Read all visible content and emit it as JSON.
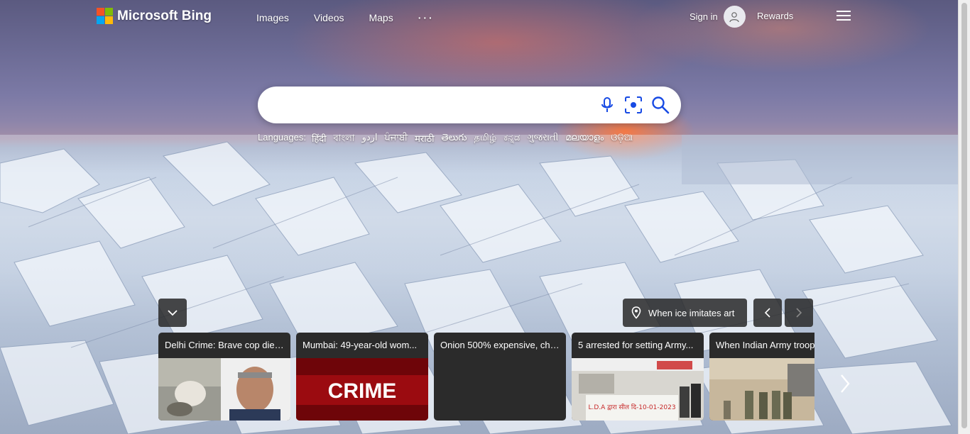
{
  "header": {
    "logo_text": "Microsoft Bing",
    "logo_colors": [
      "#f35325",
      "#81bc06",
      "#05a6f0",
      "#ffba08"
    ],
    "nav": [
      {
        "label": "Images"
      },
      {
        "label": "Videos"
      },
      {
        "label": "Maps"
      },
      {
        "label": "···"
      }
    ],
    "signin_label": "Sign in",
    "rewards_label": "Rewards",
    "menu_icon": "hamburger-icon"
  },
  "search": {
    "value": "",
    "placeholder": "",
    "icons": [
      "microphone-icon",
      "visual-search-icon",
      "search-icon"
    ],
    "accent": "#174ae4"
  },
  "languages": {
    "label": "Languages:",
    "items": [
      "हिंदी",
      "বাংলা",
      "اردو",
      "ਪੰਜਾਬੀ",
      "मराठी",
      "తెలుగు",
      "தமிழ்",
      "ಕನ್ನಡ",
      "ગુજરાતી",
      "മലയാളം",
      "ଓଡ଼ିଆ"
    ]
  },
  "image_info": {
    "title": "When ice imitates art",
    "icon": "location-pin-icon"
  },
  "news": [
    {
      "title": "Delhi Crime: Brave cop dies..."
    },
    {
      "title": "Mumbai: 49-year-old wom..."
    },
    {
      "title": "Onion 500% expensive, chi..."
    },
    {
      "title": "5 arrested for setting Army..."
    },
    {
      "title": "When Indian Army troop"
    }
  ],
  "news_images": {
    "crime_text": "CRIME",
    "banner_text": "L.D.A द्वारा सील दि-10-01-2023"
  }
}
